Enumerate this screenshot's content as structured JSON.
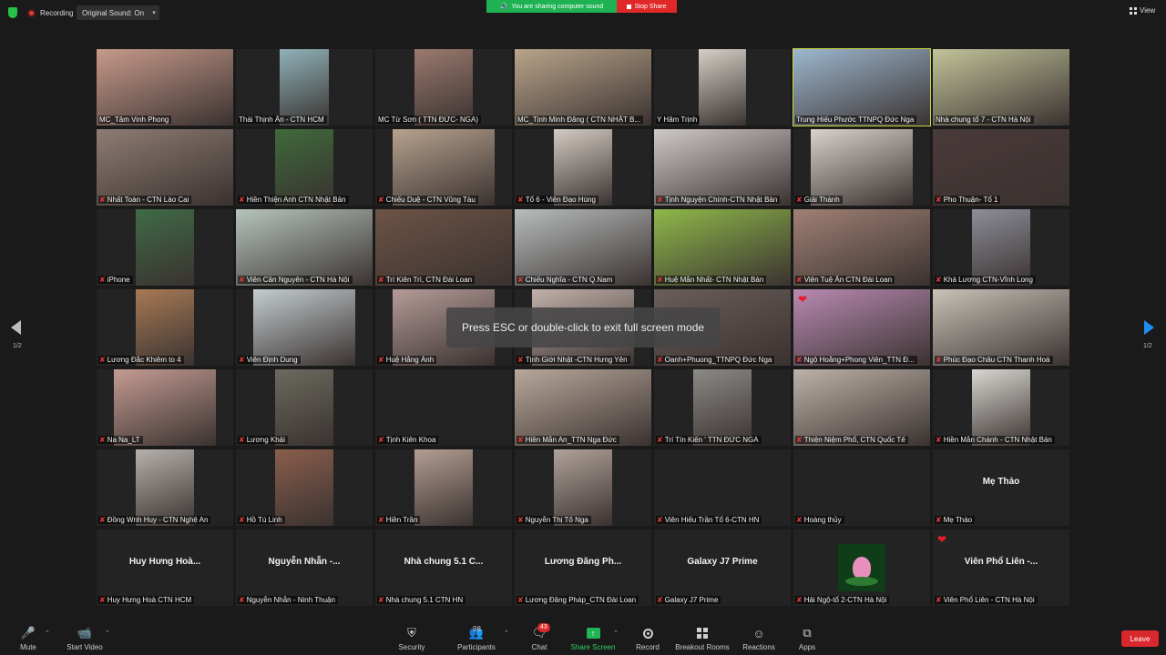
{
  "topbar": {
    "recording_label": "Recording",
    "original_sound": "Original Sound: On",
    "sharing_text": "You are sharing computer sound",
    "stop_share": "Stop Share",
    "view_label": "View"
  },
  "gallery": {
    "page_left": "1/2",
    "page_right": "1/2",
    "toast": "Press ESC or double-click to exit full screen mode",
    "tiles": [
      {
        "name": "MC_Tâm Vinh Phong",
        "video": "#c79a8a",
        "vx": 0,
        "vw": 150
      },
      {
        "name": "Thái Thịnh Ân - CTN HCM",
        "video": "#8fb2b8",
        "vx": 48,
        "vw": 54
      },
      {
        "name": "MC Từ Sơn ( TTN ĐỨC- NGA)",
        "video": "#9b7a6e",
        "vx": 43,
        "vw": 64
      },
      {
        "name": "MC_Tịnh Minh Đăng ( CTN NHẬT B...",
        "video": "#b9a48a",
        "vx": 0,
        "vw": 150
      },
      {
        "name": "Y Hâm Trịnh",
        "video": "#d6cfc6",
        "vx": 49,
        "vw": 52
      },
      {
        "name": "Trung Hiếu Phước TTNPQ Đức Nga",
        "video": "#9db7cf",
        "vx": 0,
        "vw": 150,
        "active": true
      },
      {
        "name": "Nhà chung tổ 7 - CTN Hà Nội",
        "video": "#c2c49a",
        "vx": 0,
        "vw": 150
      },
      {
        "name": "Nhất Toàn - CTN Lào Cai",
        "video": "#8e7c73",
        "vx": 0,
        "vw": 150,
        "muted": true
      },
      {
        "name": "Hiền Thiện Anh CTN Nhật Bản",
        "video": "#3e6a3a",
        "vx": 43,
        "vw": 64,
        "muted": true
      },
      {
        "name": "Chiếu Duệ - CTN Vũng Tàu",
        "video": "#b7a28e",
        "vx": 19,
        "vw": 112,
        "muted": true
      },
      {
        "name": "Tổ 6  - Viên Đạo Hùng",
        "video": "#d3cbc2",
        "vx": 43,
        "vw": 64,
        "muted": true
      },
      {
        "name": "Tịnh Nguyện Chính-CTN Nhật Bản",
        "video": "#cfc9c8",
        "vx": 0,
        "vw": 150,
        "muted": true
      },
      {
        "name": "Giải Thành",
        "video": "#d9d2cb",
        "vx": 19,
        "vw": 112,
        "muted": true
      },
      {
        "name": "Pho Thuận- Tổ 1",
        "video": "#4a3a3a",
        "vx": 0,
        "vw": 150,
        "muted": true
      },
      {
        "name": "iPhone",
        "video": "#3f6b46",
        "vx": 43,
        "vw": 64,
        "muted": true
      },
      {
        "name": "Viên Cần Nguyên - CTN Hà Nội",
        "video": "#b6c4bb",
        "vx": 0,
        "vw": 150,
        "muted": true
      },
      {
        "name": "Trí Kiên Trì, CTN Đài Loan",
        "video": "#6d5345",
        "vx": 0,
        "vw": 150,
        "muted": true
      },
      {
        "name": "Chiếu Nghĩa - CTN Q.Nam",
        "video": "#b8bdbd",
        "vx": 0,
        "vw": 150,
        "muted": true
      },
      {
        "name": "Huệ Mẫn Nhất- CTN Nhật Bản",
        "video": "#8fb84a",
        "vx": 0,
        "vw": 150,
        "muted": true
      },
      {
        "name": "Viên Tuệ Ân CTN Đài Loan",
        "video": "#a08074",
        "vx": 0,
        "vw": 150,
        "muted": true
      },
      {
        "name": "Khả Lương CTN-Vĩnh Long",
        "video": "#8d8e99",
        "vx": 43,
        "vw": 64,
        "muted": true
      },
      {
        "name": "Lương Đắc Khiêm to 4",
        "video": "#a77a56",
        "vx": 43,
        "vw": 64,
        "muted": true
      },
      {
        "name": "Viên Định Dung",
        "video": "#c4cdd0",
        "vx": 19,
        "vw": 112,
        "muted": true
      },
      {
        "name": "Huệ Hằng Ánh",
        "video": "#b59b98",
        "vx": 19,
        "vw": 112,
        "muted": true
      },
      {
        "name": "Tịnh Giới Nhật -CTN Hưng Yên",
        "video": "#c2b1aa",
        "vx": 19,
        "vw": 112,
        "muted": true
      },
      {
        "name": "Oanh+Phuong_TTNPQ Đức Nga",
        "video": "#6a5e5a",
        "vx": 0,
        "vw": 150,
        "muted": true
      },
      {
        "name": "Ngộ Hoằng+Phong Viên_TTN Đ...",
        "video": "#b98ab2",
        "vx": 0,
        "vw": 150,
        "muted": true,
        "heart": true
      },
      {
        "name": "Phúc Đạo Châu CTN Thanh Hoá",
        "video": "#c8c2b8",
        "vx": 0,
        "vw": 150,
        "muted": true
      },
      {
        "name": "Na Na_LT",
        "video": "#c49b92",
        "vx": 19,
        "vw": 112,
        "muted": true
      },
      {
        "name": "Lương Khải",
        "video": "#6b6a5f",
        "vx": 43,
        "vw": 64,
        "muted": true
      },
      {
        "name": "Tịnh Kiên Khoa",
        "video": "",
        "vx": 0,
        "vw": 0,
        "muted": true
      },
      {
        "name": "Hiền Mẫn An_TTN Nga Đức",
        "video": "#b8a89b",
        "vx": 0,
        "vw": 150,
        "muted": true
      },
      {
        "name": "Trí Tín Kiến ' TTN ĐỨC NGA",
        "video": "#8c8a86",
        "vx": 43,
        "vw": 64,
        "muted": true
      },
      {
        "name": "Thiện Niệm Phổ, CTN Quốc Tế",
        "video": "#bdb2a8",
        "vx": 0,
        "vw": 150,
        "muted": true
      },
      {
        "name": "Hiền Mẫn Chánh - CTN Nhật Bản",
        "video": "#d9d7d2",
        "vx": 43,
        "vw": 64,
        "muted": true
      },
      {
        "name": "Đồng Wnh Huy - CTN Nghệ An",
        "video": "#b6b1ac",
        "vx": 43,
        "vw": 64,
        "muted": true
      },
      {
        "name": "Hồ Tú Linh",
        "video": "#8a5e4c",
        "vx": 43,
        "vw": 64,
        "muted": true
      },
      {
        "name": "Hiền Trần",
        "video": "#b39d92",
        "vx": 43,
        "vw": 64,
        "muted": true
      },
      {
        "name": "Nguyễn Thị Tố Nga",
        "video": "#b0a29a",
        "vx": 43,
        "vw": 64,
        "muted": true
      },
      {
        "name": "Viên Hiếu Trần Tổ 6-CTN HN",
        "video": "",
        "vx": 0,
        "vw": 0,
        "muted": true
      },
      {
        "name": "Hoàng thủy",
        "video": "",
        "vx": 0,
        "vw": 0,
        "muted": true
      },
      {
        "name": "Mẹ Thảo",
        "video": "",
        "vx": 0,
        "vw": 0,
        "muted": true,
        "big": "Mẹ Thảo"
      },
      {
        "name": "Huy Hưng Hoà CTN HCM",
        "video": "",
        "vx": 0,
        "vw": 0,
        "muted": true,
        "big": "Huy Hưng Hoà..."
      },
      {
        "name": "Nguyễn Nhẫn - Ninh Thuận",
        "video": "",
        "vx": 0,
        "vw": 0,
        "muted": true,
        "big": "Nguyễn Nhẫn -..."
      },
      {
        "name": "Nhà chung 5.1 CTN HN",
        "video": "",
        "vx": 0,
        "vw": 0,
        "muted": true,
        "big": "Nhà chung 5.1 C..."
      },
      {
        "name": "Lương Đăng Pháp_CTN Đài Loan",
        "video": "",
        "vx": 0,
        "vw": 0,
        "muted": true,
        "big": "Lương Đăng Ph..."
      },
      {
        "name": "Galaxy J7 Prime",
        "video": "",
        "vx": 0,
        "vw": 0,
        "muted": true,
        "big": "Galaxy J7 Prime"
      },
      {
        "name": "Hải Ngộ-tổ 2-CTN Hà Nội",
        "video": "",
        "vx": 0,
        "vw": 0,
        "muted": true,
        "lotus": true
      },
      {
        "name": "Viên Phổ Liên - CTN Hà Nội",
        "video": "",
        "vx": 0,
        "vw": 0,
        "muted": true,
        "big": "Viên Phổ Liên -...",
        "heart": true
      }
    ]
  },
  "toolbar": {
    "mute": "Mute",
    "start_video": "Start Video",
    "security": "Security",
    "participants": "Participants",
    "participants_count": "98",
    "chat": "Chat",
    "chat_badge": "43",
    "share_screen": "Share Screen",
    "record": "Record",
    "breakout_rooms": "Breakout Rooms",
    "reactions": "Reactions",
    "apps": "Apps",
    "leave": "Leave"
  },
  "colors": {
    "background": "#1a1a1a",
    "tile_background": "#232323",
    "sharing_green": "#1fb253",
    "stop_red": "#e02828",
    "active_speaker": "#c8d838",
    "leave_red": "#d9272e"
  }
}
